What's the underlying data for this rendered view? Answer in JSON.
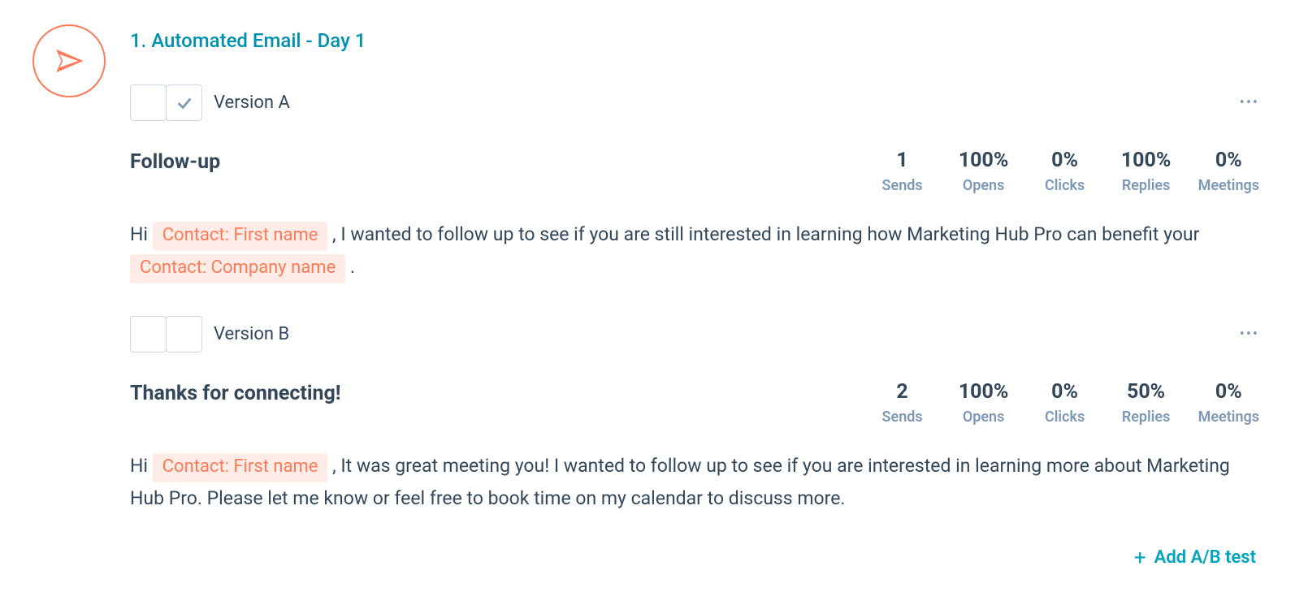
{
  "step": {
    "title": "1. Automated Email - Day 1"
  },
  "versions": [
    {
      "id": "A",
      "label": "Version A",
      "checked": true,
      "subject": "Follow-up",
      "stats": {
        "sends": {
          "value": "1",
          "label": "Sends"
        },
        "opens": {
          "value": "100%",
          "label": "Opens"
        },
        "clicks": {
          "value": "0%",
          "label": "Clicks"
        },
        "replies": {
          "value": "100%",
          "label": "Replies"
        },
        "meetings": {
          "value": "0%",
          "label": "Meetings"
        }
      },
      "body": {
        "pre1": "Hi ",
        "token1": "Contact: First name",
        "mid": ", I wanted to follow up to see if you are still interested in learning how Marketing Hub Pro can benefit your ",
        "token2": "Contact: Company name",
        "post": "."
      }
    },
    {
      "id": "B",
      "label": "Version B",
      "checked": false,
      "subject": "Thanks for connecting!",
      "stats": {
        "sends": {
          "value": "2",
          "label": "Sends"
        },
        "opens": {
          "value": "100%",
          "label": "Opens"
        },
        "clicks": {
          "value": "0%",
          "label": "Clicks"
        },
        "replies": {
          "value": "50%",
          "label": "Replies"
        },
        "meetings": {
          "value": "0%",
          "label": "Meetings"
        }
      },
      "body": {
        "pre1": "Hi ",
        "token1": "Contact: First name",
        "mid": ", It was great meeting you! I wanted to follow up to see if you are interested in learning more about Marketing Hub Pro. Please let me know or feel free to book time on my calendar to discuss more.",
        "token2": "",
        "post": ""
      }
    }
  ],
  "actions": {
    "add_ab": "Add A/B test",
    "more": "•••"
  }
}
